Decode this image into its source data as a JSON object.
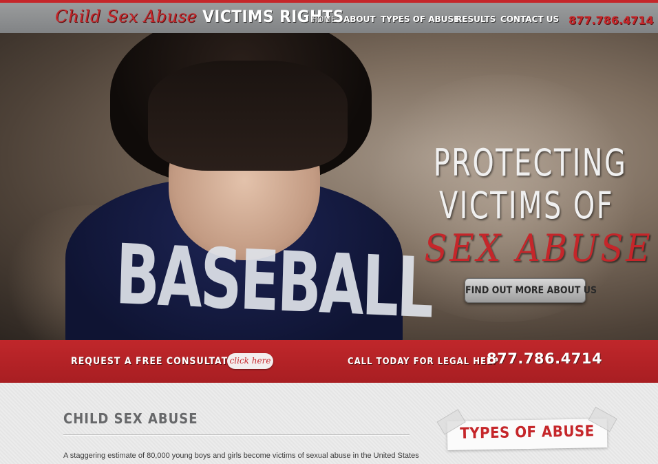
{
  "header": {
    "logo_red": "Child Sex Abuse",
    "logo_white": "VICTIMS RIGHTS",
    "phone": "877.786.4714",
    "nav": [
      {
        "label": "HOME",
        "active": true
      },
      {
        "label": "ABOUT"
      },
      {
        "label": "TYPES OF ABUSE"
      },
      {
        "label": "RESULTS"
      },
      {
        "label": "CONTACT US"
      }
    ]
  },
  "hero": {
    "line1": "PROTECTING",
    "line2": "VICTIMS OF",
    "line3": "SEX ABUSE",
    "button": "FIND OUT MORE ABOUT US",
    "shirt_text": "BASEBALL"
  },
  "band": {
    "request_label": "REQUEST A FREE CONSULTATION",
    "click_label": "click here",
    "call_label": "CALL TODAY FOR LEGAL HELP",
    "phone": "877.786.4714"
  },
  "content": {
    "title": "CHILD SEX ABUSE",
    "text": "A staggering estimate of 80,000 young boys and girls become victims of sexual abuse in the United States",
    "sidebar_title": "TYPES OF ABUSE"
  },
  "colors": {
    "brand_red": "#c5262a",
    "header_gray": "#8e9091"
  }
}
